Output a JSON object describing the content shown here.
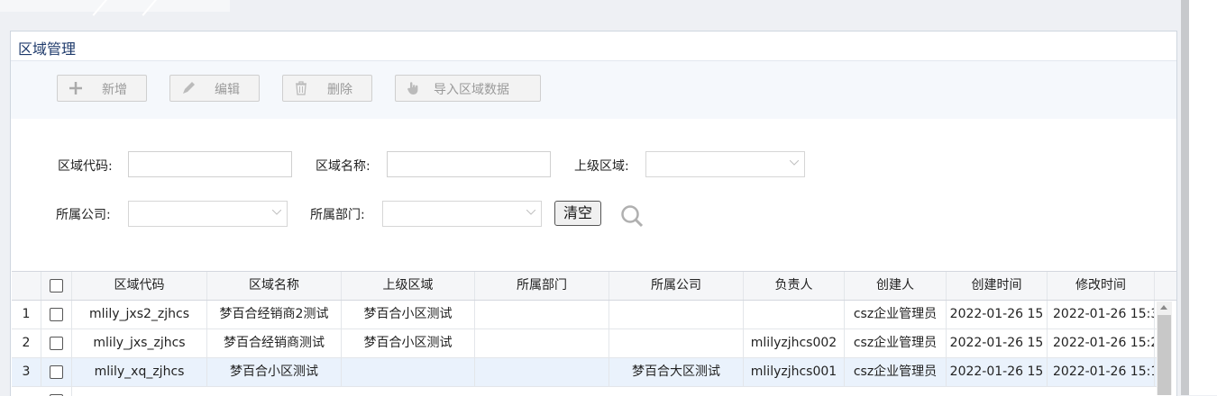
{
  "panel": {
    "title": "区域管理"
  },
  "toolbar": {
    "add_label": "新增",
    "edit_label": "编辑",
    "delete_label": "删除",
    "import_label": "导入区域数据"
  },
  "filters": {
    "area_code_label": "区域代码:",
    "area_name_label": "区域名称:",
    "parent_area_label": "上级区域:",
    "company_label": "所属公司:",
    "department_label": "所属部门:",
    "clear_label": "清空"
  },
  "grid": {
    "columns": [
      "区域代码",
      "区域名称",
      "上级区域",
      "所属部门",
      "所属公司",
      "负责人",
      "创建人",
      "创建时间",
      "修改时间"
    ],
    "rows": [
      {
        "num": "1",
        "code": "mlily_jxs2_zjhcs",
        "name": "梦百合经销商2测试",
        "parent": "梦百合小区测试",
        "dept": "",
        "company": "",
        "owner": "",
        "creator": "csz企业管理员",
        "created": "2022-01-26 15",
        "modified": "2022-01-26 15:3"
      },
      {
        "num": "2",
        "code": "mlily_jxs_zjhcs",
        "name": "梦百合经销商测试",
        "parent": "梦百合小区测试",
        "dept": "",
        "company": "",
        "owner": "mlilyzjhcs002",
        "creator": "csz企业管理员",
        "created": "2022-01-26 15",
        "modified": "2022-01-26 15:2"
      },
      {
        "num": "3",
        "code": "mlily_xq_zjhcs",
        "name": "梦百合小区测试",
        "parent": "",
        "dept": "",
        "company": "梦百合大区测试",
        "owner": "mlilyzjhcs001",
        "creator": "csz企业管理员",
        "created": "2022-01-26 15",
        "modified": "2022-01-26 15:1"
      }
    ]
  },
  "colors": {
    "selected_row": "#eaf2fc",
    "title": "#1e3a6b"
  }
}
